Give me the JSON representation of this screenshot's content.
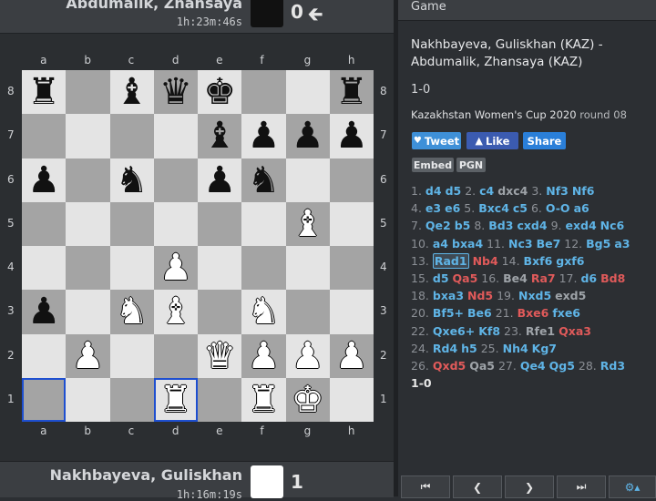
{
  "top_player": {
    "name": "Abdumalik, Zhansaya",
    "clock": "1h:23m:46s",
    "score": "0",
    "color": "#111111"
  },
  "bottom_player": {
    "name": "Nakhbayeva, Guliskhan",
    "clock": "1h:16m:19s",
    "score": "1",
    "color": "#ffffff"
  },
  "files": [
    "a",
    "b",
    "c",
    "d",
    "e",
    "f",
    "g",
    "h"
  ],
  "ranks": [
    "8",
    "7",
    "6",
    "5",
    "4",
    "3",
    "2",
    "1"
  ],
  "board": [
    [
      "bR",
      "",
      "bB",
      "bQ",
      "bK",
      "",
      "",
      "bR"
    ],
    [
      "",
      "",
      "",
      "",
      "bB",
      "bP",
      "bP",
      "bP"
    ],
    [
      "bP",
      "",
      "bN",
      "",
      "bP",
      "bN",
      "",
      ""
    ],
    [
      "",
      "",
      "",
      "",
      "",
      "",
      "wB",
      ""
    ],
    [
      "",
      "",
      "",
      "wP",
      "",
      "",
      "",
      ""
    ],
    [
      "bP",
      "",
      "wN",
      "wB",
      "",
      "wN",
      "",
      ""
    ],
    [
      "",
      "wP",
      "",
      "",
      "wQ",
      "wP",
      "wP",
      "wP"
    ],
    [
      "",
      "",
      "",
      "wR",
      "",
      "wR",
      "wK",
      ""
    ]
  ],
  "highlight_squares": [
    "a1",
    "d1"
  ],
  "panel": {
    "header": "Game",
    "title": "Nakhbayeva, Guliskhan (KAZ) - Abdumalik, Zhansaya (KAZ)",
    "result": "1-0",
    "event": "Kazakhstan Women's Cup 2020",
    "round": "round 08",
    "tweet": "Tweet",
    "like": "Like",
    "share": "Share",
    "embed": "Embed",
    "pgn": "PGN"
  },
  "moves_text": [
    [
      [
        "mn",
        "1."
      ],
      [
        "m",
        "d4"
      ],
      [
        "m",
        "d5"
      ],
      [
        "mn",
        "2."
      ],
      [
        "m",
        "c4"
      ],
      [
        "g",
        "dxc4"
      ],
      [
        "mn",
        "3."
      ],
      [
        "m",
        "Nf3"
      ],
      [
        "m",
        "Nf6"
      ]
    ],
    [
      [
        "mn",
        "4."
      ],
      [
        "m",
        "e3"
      ],
      [
        "m",
        "e6"
      ],
      [
        "mn",
        "5."
      ],
      [
        "m",
        "Bxc4"
      ],
      [
        "m",
        "c5"
      ],
      [
        "mn",
        "6."
      ],
      [
        "m",
        "O-O"
      ],
      [
        "m",
        "a6"
      ]
    ],
    [
      [
        "mn",
        "7."
      ],
      [
        "m",
        "Qe2"
      ],
      [
        "m",
        "b5"
      ],
      [
        "mn",
        "8."
      ],
      [
        "m",
        "Bd3"
      ],
      [
        "m",
        "cxd4"
      ],
      [
        "mn",
        "9."
      ],
      [
        "m",
        "exd4"
      ],
      [
        "m",
        "Nc6"
      ]
    ],
    [
      [
        "mn",
        "10."
      ],
      [
        "m",
        "a4"
      ],
      [
        "m",
        "bxa4"
      ],
      [
        "mn",
        "11."
      ],
      [
        "m",
        "Nc3"
      ],
      [
        "m",
        "Be7"
      ],
      [
        "mn",
        "12."
      ],
      [
        "m",
        "Bg5"
      ],
      [
        "m",
        "a3"
      ]
    ],
    [
      [
        "mn",
        "13."
      ],
      [
        "cur",
        "Rad1"
      ],
      [
        "x",
        "Nb4"
      ],
      [
        "mn",
        "14."
      ],
      [
        "m",
        "Bxf6"
      ],
      [
        "m",
        "gxf6"
      ]
    ],
    [
      [
        "mn",
        "15."
      ],
      [
        "m",
        "d5"
      ],
      [
        "x",
        "Qa5"
      ],
      [
        "mn",
        "16."
      ],
      [
        "g",
        "Be4"
      ],
      [
        "x",
        "Ra7"
      ],
      [
        "mn",
        "17."
      ],
      [
        "m",
        "d6"
      ],
      [
        "x",
        "Bd8"
      ]
    ],
    [
      [
        "mn",
        "18."
      ],
      [
        "m",
        "bxa3"
      ],
      [
        "x",
        "Nd5"
      ],
      [
        "mn",
        "19."
      ],
      [
        "m",
        "Nxd5"
      ],
      [
        "g",
        "exd5"
      ]
    ],
    [
      [
        "mn",
        "20."
      ],
      [
        "m",
        "Bf5+"
      ],
      [
        "m",
        "Be6"
      ],
      [
        "mn",
        "21."
      ],
      [
        "x",
        "Bxe6"
      ],
      [
        "m",
        "fxe6"
      ]
    ],
    [
      [
        "mn",
        "22."
      ],
      [
        "m",
        "Qxe6+"
      ],
      [
        "m",
        "Kf8"
      ],
      [
        "mn",
        "23."
      ],
      [
        "g",
        "Rfe1"
      ],
      [
        "x",
        "Qxa3"
      ]
    ],
    [
      [
        "mn",
        "24."
      ],
      [
        "m",
        "Rd4"
      ],
      [
        "m",
        "h5"
      ],
      [
        "mn",
        "25."
      ],
      [
        "m",
        "Nh4"
      ],
      [
        "m",
        "Kg7"
      ]
    ],
    [
      [
        "mn",
        "26."
      ],
      [
        "x",
        "Qxd5"
      ],
      [
        "g",
        "Qa5"
      ],
      [
        "mn",
        "27."
      ],
      [
        "m",
        "Qe4"
      ],
      [
        "m",
        "Qg5"
      ],
      [
        "mn",
        "28."
      ],
      [
        "m",
        "Rd3"
      ]
    ],
    [
      [
        "res",
        "1-0"
      ]
    ]
  ],
  "nav": {
    "first": "first-move-icon",
    "prev": "prev-move-icon",
    "next": "next-move-icon",
    "last": "last-move-icon",
    "settings": "gear-icon"
  },
  "colors": {
    "tweet": "#3e90d8",
    "like": "#3b5bb0",
    "share": "#2a7fd9",
    "highlight": "#1e4fd0"
  }
}
